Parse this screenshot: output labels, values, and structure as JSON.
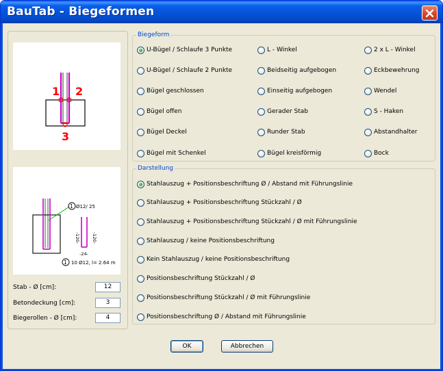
{
  "window": {
    "title": "BauTab - Biegeformen"
  },
  "biegeform": {
    "title": "Biegeform",
    "options": [
      {
        "label": "U-Bügel / Schlaufe 3 Punkte",
        "checked": true
      },
      {
        "label": "L - Winkel",
        "checked": false
      },
      {
        "label": "2 x L - Winkel",
        "checked": false
      },
      {
        "label": "U-Bügel / Schlaufe 2 Punkte",
        "checked": false
      },
      {
        "label": "Beidseitig aufgebogen",
        "checked": false
      },
      {
        "label": "Eckbewehrung",
        "checked": false
      },
      {
        "label": "Bügel geschlossen",
        "checked": false
      },
      {
        "label": "Einseitig aufgebogen",
        "checked": false
      },
      {
        "label": "Wendel",
        "checked": false
      },
      {
        "label": "Bügel offen",
        "checked": false
      },
      {
        "label": "Gerader Stab",
        "checked": false
      },
      {
        "label": "S - Haken",
        "checked": false
      },
      {
        "label": "Bügel Deckel",
        "checked": false
      },
      {
        "label": "Runder Stab",
        "checked": false
      },
      {
        "label": "Abstandhalter",
        "checked": false
      },
      {
        "label": "Bügel mit Schenkel",
        "checked": false
      },
      {
        "label": "Bügel kreisförmig",
        "checked": false
      },
      {
        "label": "Bock",
        "checked": false
      }
    ]
  },
  "darstellung": {
    "title": "Darstellung",
    "options": [
      {
        "label": "Stahlauszug + Positionsbeschriftung  Ø / Abstand mit Führungslinie",
        "checked": true
      },
      {
        "label": "Stahlauszug + Positionsbeschriftung Stückzahl / Ø",
        "checked": false
      },
      {
        "label": "Stahlauszug + Positionsbeschriftung Stückzahl / Ø  mit Führungslinie",
        "checked": false
      },
      {
        "label": "Stahlauszug / keine Positionsbeschriftung",
        "checked": false
      },
      {
        "label": "Kein Stahlauszug / keine Positionsbeschriftung",
        "checked": false
      },
      {
        "label": "Positionsbeschriftung Stückzahl / Ø",
        "checked": false
      },
      {
        "label": "Positionsbeschriftung Stückzahl / Ø  mit Führungslinie",
        "checked": false
      },
      {
        "label": "Positionsbeschriftung  Ø / Abstand mit Führungslinie",
        "checked": false
      }
    ]
  },
  "preview_top": {
    "points": [
      "1",
      "2",
      "3"
    ]
  },
  "preview_bottom": {
    "pos_label": "1",
    "diameter_spacing": "Ø12/ 25",
    "leg_left": "-120-",
    "leg_right": "-120-",
    "bottom_length": "-24-",
    "summary_pos": "1",
    "summary_text": "10 Ø12, l= 2.64 m"
  },
  "fields": {
    "stab": {
      "label": "Stab - Ø [cm]:",
      "value": "12"
    },
    "betondeckung": {
      "label": "Betondeckung [cm]:",
      "value": "3"
    },
    "biegerollen": {
      "label": "Biegerollen - Ø [cm]:",
      "value": "4"
    }
  },
  "buttons": {
    "ok": "OK",
    "cancel": "Abbrechen"
  },
  "colors": {
    "accent": "#0046d5",
    "highlight": "#ff0000",
    "bar": "#cc00cc"
  }
}
